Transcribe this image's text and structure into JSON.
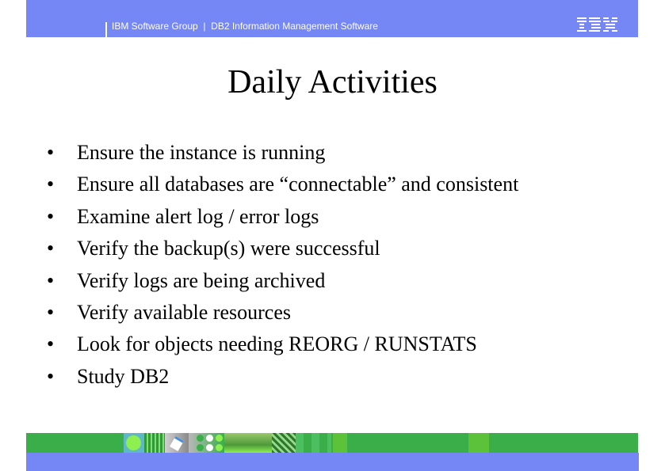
{
  "header": {
    "text": "IBM Software Group  |  DB2 Information Management Software",
    "logo": "IBM"
  },
  "slide": {
    "title": "Daily Activities",
    "bullets": [
      "Ensure the instance is running",
      "Ensure all databases are “connectable” and consistent",
      "Examine alert log / error logs",
      "Verify the backup(s) were successful",
      "Verify logs are being archived",
      "Verify available resources",
      "Look for objects needing REORG / RUNSTATS",
      "Study DB2"
    ],
    "bullet_glyph": "•"
  },
  "colors": {
    "header_blue": "#7586f5",
    "footer_green": "#3aaf49",
    "accent_lime": "#8ef050"
  }
}
